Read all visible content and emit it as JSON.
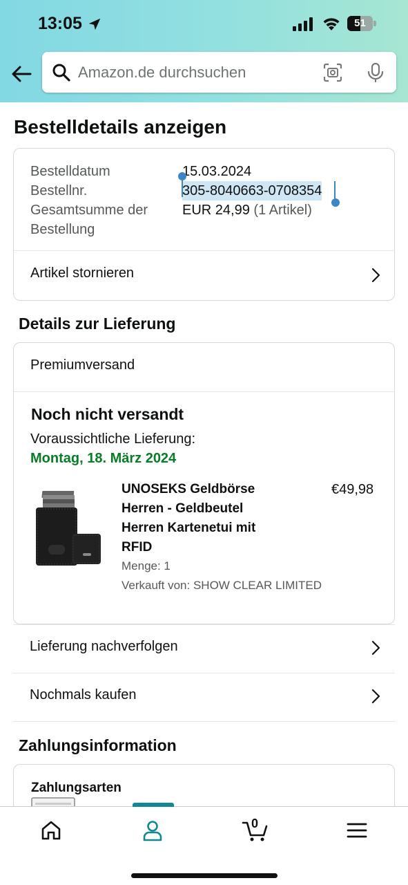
{
  "status_bar": {
    "time": "13:05",
    "battery_percent": "51",
    "battery_level": 0.51
  },
  "search": {
    "placeholder": "Amazon.de durchsuchen"
  },
  "page": {
    "title": "Bestelldetails anzeigen"
  },
  "order_summary": {
    "date_label": "Bestelldatum",
    "date_value": "15.03.2024",
    "number_label": "Bestellnr.",
    "number_value": "305-8040663-0708354",
    "total_label_line1": "Gesamtsumme der",
    "total_label_line2": "Bestellung",
    "total_value": "EUR 24,99",
    "total_items": "(1 Artikel)",
    "cancel_label": "Artikel stornieren"
  },
  "delivery": {
    "section_title": "Details zur Lieferung",
    "shipping_method": "Premiumversand",
    "status": "Noch nicht versandt",
    "expected_label": "Voraussichtliche Lieferung:",
    "expected_date": "Montag, 18. März 2024",
    "product": {
      "title_line1": "UNOSEKS Geldbörse",
      "title_line2": "Herren - Geldbeutel",
      "title_line3": "Herren Kartenetui mit",
      "title_line4": "RFID",
      "price": "€49,98",
      "quantity": "Menge: 1",
      "seller": "Verkauft von: SHOW CLEAR LIMITED"
    }
  },
  "actions": {
    "track": "Lieferung nachverfolgen",
    "buy_again": "Nochmals kaufen"
  },
  "payment": {
    "section_title": "Zahlungsinformation",
    "methods_label": "Zahlungsarten"
  },
  "bottom_nav": {
    "cart_count": "0",
    "active_tab": "account"
  },
  "colors": {
    "accent": "#118892",
    "delivery_green": "#067d26",
    "selection": "#3d86c6"
  }
}
